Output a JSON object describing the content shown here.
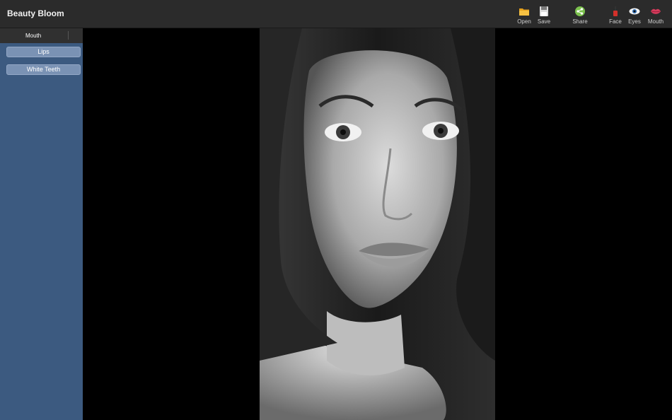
{
  "app": {
    "title": "Beauty Bloom"
  },
  "toolbar": {
    "open_label": "Open",
    "save_label": "Save",
    "share_label": "Share",
    "face_label": "Face",
    "eyes_label": "Eyes",
    "mouth_label": "Mouth"
  },
  "sidebar": {
    "tab_label": "Mouth",
    "buttons": [
      "Lips",
      "White Teeth"
    ]
  },
  "colors": {
    "sidebar": "#3c5a80",
    "toolbar": "#2b2b2b",
    "button": "#7a92b4"
  },
  "icons": [
    "folder-icon",
    "floppy-disk-icon",
    "share-icon",
    "nail-polish-icon",
    "eye-icon",
    "lips-icon"
  ]
}
